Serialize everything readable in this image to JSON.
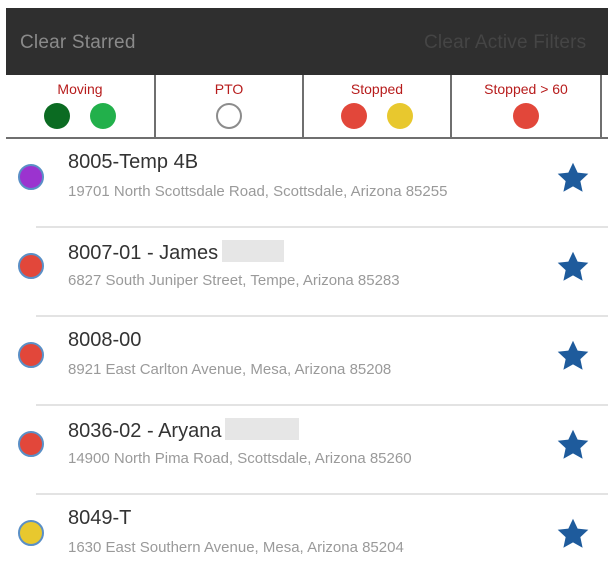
{
  "toolbar": {
    "clear_starred_label": "Clear Starred",
    "clear_filters_label": "Clear Active Filters"
  },
  "filters": [
    {
      "label": "Moving",
      "dots": [
        "#0b6b22",
        "#22b04b"
      ]
    },
    {
      "label": "PTO",
      "dots": [
        "hollow"
      ]
    },
    {
      "label": "Stopped",
      "dots": [
        "#e2473a",
        "#e8c82e"
      ]
    },
    {
      "label": "Stopped > 60",
      "dots": [
        "#e2473a"
      ]
    }
  ],
  "items": [
    {
      "title": "8005-Temp 4B",
      "address": "19701 North Scottsdale Road, Scottsdale, Arizona 85255",
      "status_color": "#9b33cf",
      "starred": true
    },
    {
      "title": "8007-01 - James",
      "address": "6827 South Juniper Street, Tempe, Arizona 85283",
      "status_color": "#e2473a",
      "starred": true
    },
    {
      "title": "8008-00",
      "address": "8921 East Carlton Avenue, Mesa, Arizona 85208",
      "status_color": "#e2473a",
      "starred": true
    },
    {
      "title": "8036-02 - Aryana",
      "address": "14900 North Pima Road, Scottsdale, Arizona 85260",
      "status_color": "#e2473a",
      "starred": true
    },
    {
      "title": "8049-T",
      "address": "1630 East Southern Avenue, Mesa, Arizona 85204",
      "status_color": "#e8c82e",
      "starred": true
    }
  ],
  "colors": {
    "star": "#1e5b9c",
    "filter_label": "#b71c1c",
    "toolbar_bg": "#2f2f2f"
  }
}
